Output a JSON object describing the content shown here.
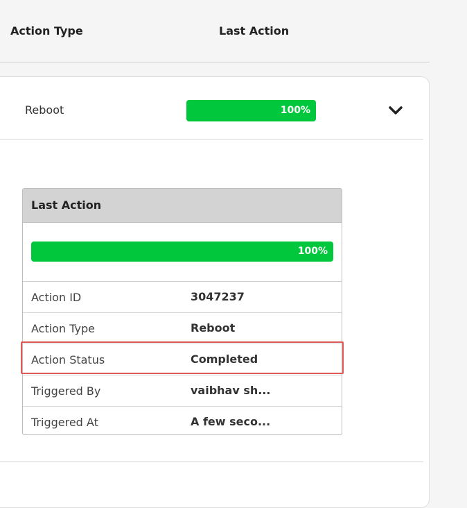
{
  "table_header": {
    "action_type": "Action Type",
    "last_action": "Last Action"
  },
  "row": {
    "type": "Reboot",
    "progress_percent": 100,
    "progress_label": "100%",
    "expand_icon": "chevron-down-icon"
  },
  "details": {
    "title": "Last Action",
    "progress_percent": 100,
    "progress_label": "100%",
    "items": [
      {
        "label": "Action ID",
        "value": "3047237"
      },
      {
        "label": "Action Type",
        "value": "Reboot"
      },
      {
        "label": "Action Status",
        "value": "Completed"
      },
      {
        "label": "Triggered By",
        "value": "vaibhav sh..."
      },
      {
        "label": "Triggered At",
        "value": "A few seco..."
      }
    ]
  },
  "colors": {
    "progress": "#00c73c",
    "highlight": "#e05a55",
    "panel_header": "#d3d3d3"
  }
}
